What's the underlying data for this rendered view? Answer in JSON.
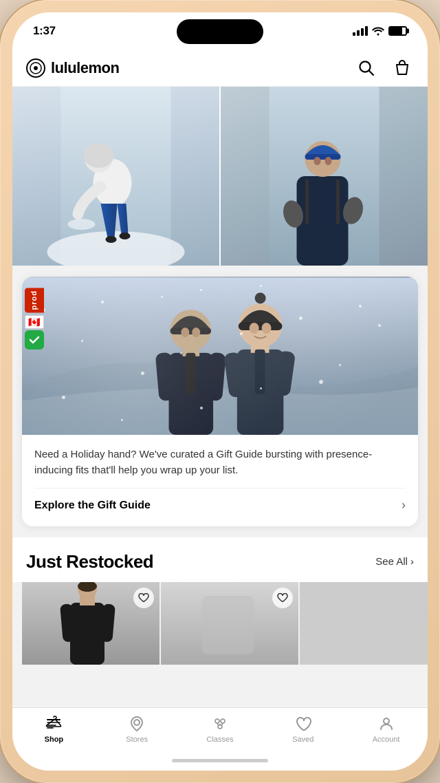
{
  "phone": {
    "time": "1:37",
    "status_icons": [
      "signal",
      "wifi",
      "battery"
    ]
  },
  "header": {
    "brand": "lululemon",
    "search_label": "search",
    "bag_label": "bag"
  },
  "gift_guide": {
    "image_alt": "Two people in winter gear in snowy landscape",
    "description": "Need a Holiday hand? We've curated a Gift Guide bursting with presence-inducing fits that'll help you wrap up your list.",
    "link_text": "Explore the Gift Guide",
    "chevron": "›"
  },
  "just_restocked": {
    "title": "Just Restocked",
    "see_all": "See All",
    "chevron": "›"
  },
  "debug_tab": {
    "label": "prod",
    "flag": "🇨🇦"
  },
  "tab_bar": {
    "items": [
      {
        "id": "shop",
        "label": "Shop",
        "active": true
      },
      {
        "id": "stores",
        "label": "Stores",
        "active": false
      },
      {
        "id": "classes",
        "label": "Classes",
        "active": false
      },
      {
        "id": "saved",
        "label": "Saved",
        "active": false
      },
      {
        "id": "account",
        "label": "Account",
        "active": false
      }
    ]
  }
}
